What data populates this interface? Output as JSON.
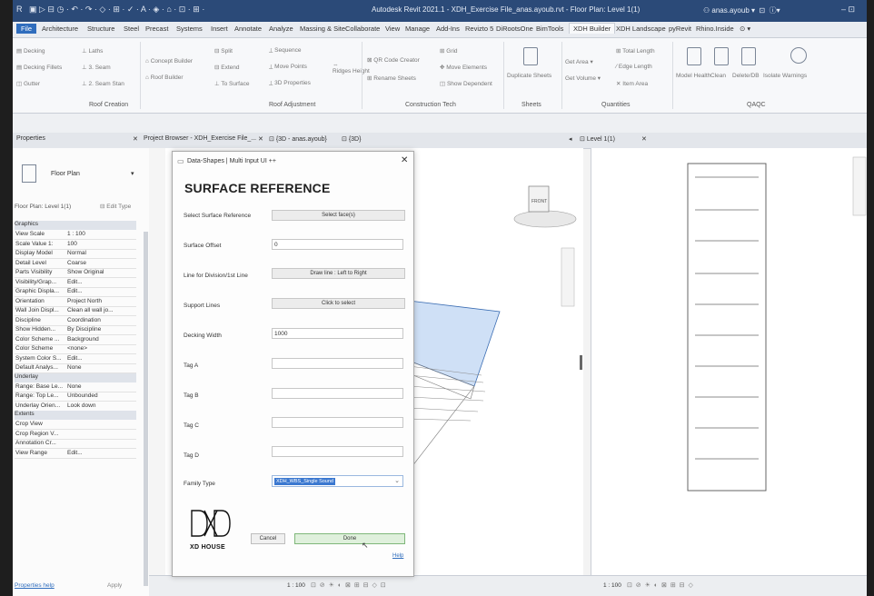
{
  "window": {
    "title": "Autodesk Revit 2021.1 - XDH_Exercise File_anas.ayoub.rvt - Floor Plan: Level 1(1)",
    "user": "anas.ayoub"
  },
  "ribbon_tabs": [
    "File",
    "Architecture",
    "Structure",
    "Steel",
    "Precast",
    "Systems",
    "Insert",
    "Annotate",
    "Analyze",
    "Massing & Site",
    "Collaborate",
    "View",
    "Manage",
    "Add-Ins",
    "Revizto 5",
    "DiRootsOne",
    "BimTools",
    "XDH Builder",
    "XDH Landscape",
    "pyRevit",
    "Rhino.Inside"
  ],
  "ribbon_active_tab": "XDH Builder",
  "ribbon": {
    "roof_creation": {
      "label": "Roof Creation",
      "items": [
        "Decking",
        "Decking Fillets",
        "Gutter",
        "Laths",
        "3. Seam",
        "2. Seam Stan"
      ]
    },
    "roof_adjustment": {
      "label": "Roof Adjustment",
      "items": [
        "Concept Builder",
        "Roof Builder",
        "Split",
        "Extend",
        "To Surface",
        "Sequence",
        "Move Points",
        "Ridges Height",
        "3D Properties"
      ]
    },
    "construction_tech": {
      "label": "Construction Tech",
      "items": [
        "QR Code Creator",
        "Rename Sheets",
        "Grid",
        "Move Elements",
        "Show Dependent"
      ]
    },
    "sheets": {
      "label": "Sheets",
      "items": [
        "Duplicate Sheets"
      ]
    },
    "quantities": {
      "label": "Quantities",
      "items": [
        "Get Area",
        "Get Volume",
        "Total Length",
        "Edge Length",
        "Item Area"
      ]
    },
    "qaqc": {
      "label": "QAQC",
      "items": [
        "Model Health",
        "Clean",
        "Delete/DB",
        "Isolate Warnings"
      ]
    }
  },
  "view_tabs": {
    "properties": "Properties",
    "browser": "Project Browser - XDH_Exercise File_...",
    "view3d": "{3D - anas.ayoub}",
    "view3d_2": "{3D}",
    "plan": "Level 1(1)"
  },
  "properties": {
    "type_name": "Floor Plan",
    "selector": "Floor Plan: Level 1(1)",
    "edit_type": "Edit Type",
    "sections": [
      {
        "name": "Graphics",
        "rows": [
          [
            "View Scale",
            "1 : 100"
          ],
          [
            "Scale Value 1:",
            "100"
          ],
          [
            "Display Model",
            "Normal"
          ],
          [
            "Detail Level",
            "Coarse"
          ],
          [
            "Parts Visibility",
            "Show Original"
          ],
          [
            "Visibility/Grap...",
            "Edit..."
          ],
          [
            "Graphic Displa...",
            "Edit..."
          ],
          [
            "Orientation",
            "Project North"
          ],
          [
            "Wall Join Displ...",
            "Clean all wall jo..."
          ],
          [
            "Discipline",
            "Coordination"
          ],
          [
            "Show Hidden...",
            "By Discipline"
          ],
          [
            "Color Scheme ...",
            "Background"
          ],
          [
            "Color Scheme",
            "<none>"
          ],
          [
            "System Color S...",
            "Edit..."
          ],
          [
            "Default Analys...",
            "None"
          ]
        ]
      },
      {
        "name": "Underlay",
        "rows": [
          [
            "Range: Base Le...",
            "None"
          ],
          [
            "Range: Top Le...",
            "Unbounded"
          ],
          [
            "Underlay Orien...",
            "Look down"
          ]
        ]
      },
      {
        "name": "Extents",
        "rows": [
          [
            "Crop View",
            ""
          ],
          [
            "Crop Region V...",
            ""
          ],
          [
            "Annotation Cr...",
            ""
          ],
          [
            "View Range",
            "Edit..."
          ]
        ]
      }
    ],
    "help_link": "Properties help",
    "apply": "Apply"
  },
  "dialog": {
    "window_title": "Data-Shapes | Multi Input UI ++",
    "heading": "SURFACE REFERENCE",
    "fields": [
      {
        "label": "Select Surface Reference",
        "kind": "button",
        "value": "Select face(s)"
      },
      {
        "label": "Surface Offset",
        "kind": "input",
        "value": "0"
      },
      {
        "label": "Line for Division/1st Line",
        "kind": "button",
        "value": "Draw line : Left to Right"
      },
      {
        "label": "Support Lines",
        "kind": "button",
        "value": "Click to select"
      },
      {
        "label": "Decking Width",
        "kind": "input",
        "value": "1000"
      },
      {
        "label": "Tag A",
        "kind": "input",
        "value": ""
      },
      {
        "label": "Tag B",
        "kind": "input",
        "value": ""
      },
      {
        "label": "Tag C",
        "kind": "input",
        "value": ""
      },
      {
        "label": "Tag D",
        "kind": "input",
        "value": ""
      },
      {
        "label": "Family Type",
        "kind": "select",
        "value": "XDH_WBS_Single Sound"
      }
    ],
    "logo_text": "XD HOUSE",
    "cancel": "Cancel",
    "done": "Done",
    "help": "Help"
  },
  "status": {
    "scale_left": "1 : 100",
    "scale_right": "1 : 100"
  },
  "colors": {
    "titlebar": "#2b4a78",
    "file_tab": "#2f6dbd",
    "roof_surface": "#cfe0f6",
    "selection": "#3b78d0"
  }
}
